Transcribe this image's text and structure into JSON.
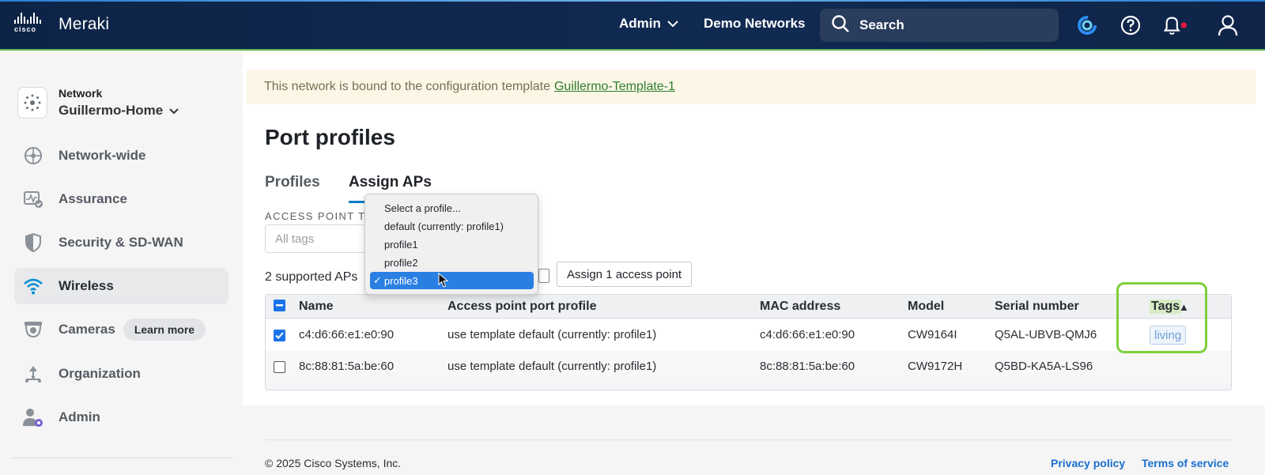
{
  "topbar": {
    "brand": "Meraki",
    "cisco_word": "cisco",
    "admin_label": "Admin",
    "demo_label": "Demo Networks",
    "search_placeholder": "Search",
    "icons": [
      "meraki-swirl-icon",
      "help-icon",
      "bell-icon",
      "user-icon"
    ],
    "notification_dot_color": "#e0193f"
  },
  "sidebar": {
    "network_label": "Network",
    "network_name": "Guillermo-Home",
    "items": [
      {
        "label": "Network-wide",
        "icon": "network-wide-icon"
      },
      {
        "label": "Assurance",
        "icon": "assurance-icon"
      },
      {
        "label": "Security & SD-WAN",
        "icon": "shield-icon"
      },
      {
        "label": "Wireless",
        "icon": "wifi-icon",
        "active": true
      },
      {
        "label": "Cameras",
        "icon": "camera-icon",
        "badge": "Learn more"
      },
      {
        "label": "Organization",
        "icon": "organization-icon"
      },
      {
        "label": "Admin",
        "icon": "admin-icon"
      }
    ]
  },
  "banner": {
    "text": "This network is bound to the configuration template",
    "link": "Guillermo-Template-1"
  },
  "page": {
    "title": "Port profiles",
    "tabs": [
      "Profiles",
      "Assign APs"
    ],
    "active_tab": "Assign APs",
    "access_point_tags_label": "ACCESS POINT TA",
    "tags_placeholder": "All tags",
    "supported_text": "2 supported APs",
    "assign_button": "Assign 1 access point"
  },
  "dropdown": {
    "options": [
      "Select a profile...",
      "default (currently: profile1)",
      "profile1",
      "profile2",
      "profile3"
    ],
    "selected": "profile3",
    "check": "✓"
  },
  "table": {
    "columns": [
      "Name",
      "Access point port profile",
      "MAC address",
      "Model",
      "Serial number",
      "Tags"
    ],
    "sort_indicator": "▲",
    "rows": [
      {
        "checked": true,
        "name": "c4:d6:66:e1:e0:90",
        "profile": "use template default (currently: profile1)",
        "mac": "c4:d6:66:e1:e0:90",
        "model": "CW9164I",
        "serial": "Q5AL-UBVB-QMJ6",
        "tags": "living"
      },
      {
        "checked": false,
        "name": "8c:88:81:5a:be:60",
        "profile": "use template default (currently: profile1)",
        "mac": "8c:88:81:5a:be:60",
        "model": "CW9172H",
        "serial": "Q5BD-KA5A-LS96",
        "tags": ""
      }
    ]
  },
  "footer": {
    "copyright": "© 2025 Cisco Systems, Inc.",
    "privacy": "Privacy policy",
    "terms": "Terms of service"
  },
  "colors": {
    "topbar": "#0d2447",
    "accent_blue": "#0a7dc9",
    "highlight_green": "#7fcf3a",
    "banner_bg": "#fbf6e6"
  }
}
